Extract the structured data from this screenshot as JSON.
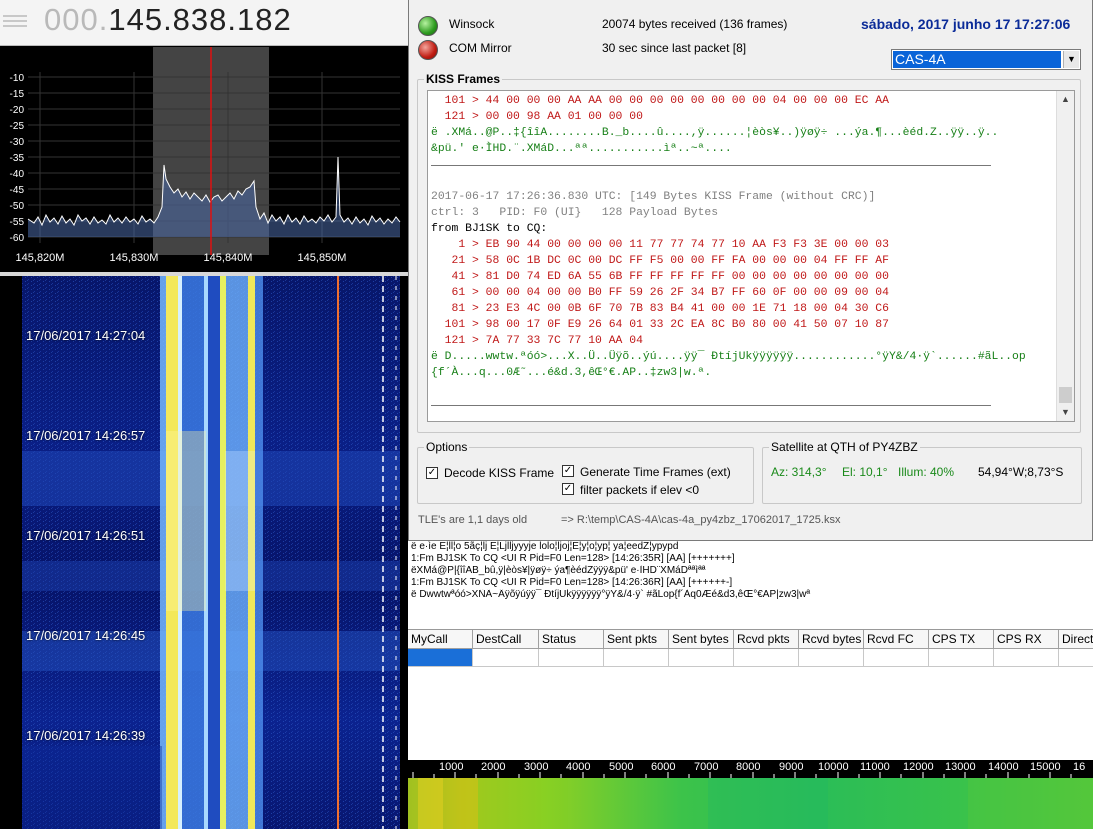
{
  "sdr": {
    "freq_dim": "000.",
    "freq_main": "145.838.182",
    "spectrum": {
      "y_ticks": [
        "-10",
        "-15",
        "-20",
        "-25",
        "-30",
        "-35",
        "-40",
        "-45",
        "-50",
        "-55",
        "-60"
      ],
      "x_ticks": [
        "145,820M",
        "145,830M",
        "145,840M",
        "145,850M"
      ]
    },
    "waterfall_times": [
      "17/06/2017 14:27:04",
      "17/06/2017 14:26:57",
      "17/06/2017 14:26:51",
      "17/06/2017 14:26:45",
      "17/06/2017 14:26:39"
    ]
  },
  "status": {
    "winsock_label": "Winsock",
    "winsock_info": "20074 bytes received (136 frames)",
    "com_label": "COM Mirror",
    "com_info": "30 sec since last packet [8]",
    "date": "sábado, 2017 junho 17  17:27:06",
    "satellite": "CAS-4A"
  },
  "kiss": {
    "legend": "KISS Frames",
    "lines": [
      {
        "c": "r",
        "t": "  101 > 44 00 00 00 AA AA 00 00 00 00 00 00 00 00 04 00 00 00 EC AA"
      },
      {
        "c": "r",
        "t": "  121 > 00 00 98 AA 01 00 00 00"
      },
      {
        "c": "g",
        "t": "ë .XMá..@P..‡{îîA........B._b....û....,ÿ......¦èòs¥..)ÿøÿ÷ ...ýa.¶...èéd.Z..ÿÿ..ÿ.."
      },
      {
        "c": "g",
        "t": "&pü.' e·ÌHD.¨.XMáD...ªª...........ìª..~ª...."
      },
      {
        "c": "sep",
        "t": ""
      },
      {
        "c": "b",
        "t": ""
      },
      {
        "c": "gr",
        "t": "2017-06-17 17:26:36.830 UTC: [149 Bytes KISS Frame (without CRC)]"
      },
      {
        "c": "gr",
        "t": "ctrl: 3   PID: F0 (UI}   128 Payload Bytes"
      },
      {
        "c": "b",
        "t": "from BJ1SK to CQ:"
      },
      {
        "c": "r",
        "t": "    1 > EB 90 44 00 00 00 00 11 77 77 74 77 10 AA F3 F3 3E 00 00 03"
      },
      {
        "c": "r",
        "t": "   21 > 58 0C 1B DC 0C 00 DC FF F5 00 00 FF FA 00 00 00 04 FF FF AF"
      },
      {
        "c": "r",
        "t": "   41 > 81 D0 74 ED 6A 55 6B FF FF FF FF FF 00 00 00 00 00 00 00 00"
      },
      {
        "c": "r",
        "t": "   61 > 00 00 04 00 00 B0 FF 59 26 2F 34 B7 FF 60 0F 00 00 09 00 04"
      },
      {
        "c": "r",
        "t": "   81 > 23 E3 4C 00 0B 6F 70 7B 83 B4 41 00 00 1E 71 18 00 04 30 C6"
      },
      {
        "c": "r",
        "t": "  101 > 98 00 17 0F E9 26 64 01 33 2C EA 8C B0 80 00 41 50 07 10 87"
      },
      {
        "c": "r",
        "t": "  121 > 7A 77 33 7C 77 10 AA 04"
      },
      {
        "c": "g",
        "t": "ë D.....wwtw.ªóó>...X..Ü..Üÿõ..ýú....ÿÿ¯ ÐtíjUkÿÿÿÿÿÿ............°ÿY&/4·ÿ`......#ãL..op"
      },
      {
        "c": "g",
        "t": "{f´À...q...0Æ˜...é&d.3,êŒ°€.AP..‡zw3|w.ª."
      },
      {
        "c": "b",
        "t": ""
      },
      {
        "c": "sep",
        "t": ""
      }
    ]
  },
  "options": {
    "legend": "Options",
    "decode_kiss": "Decode KISS Frame",
    "gen_time": "Generate Time Frames (ext)",
    "filter_elev": "filter packets if elev <0"
  },
  "qth": {
    "legend": "Satellite at QTH of PY4ZBZ",
    "az": "Az: 314,3°",
    "el": "El: 10,1°",
    "illum": "Illum: 40%",
    "pos": "54,94°W;8,73°S"
  },
  "tle_info": "TLE's are 1,1 days old",
  "tle_path": "=> R:\\temp\\CAS-4A\\cas-4a_py4zbz_17062017_1725.ksx",
  "log_lines": [
    "ë e·ìe  E¦ll¦o  5ãç¦lj E¦Ljlljyyyje              lolo¦ljoj¦E¦y¦o¦yp¦ ya¦eedZ¦ypypd",
    "1:Fm BJ1SK To CQ <UI R Pid=F0 Len=128> [14:26:35R] [AA] [+++++++]",
    "ëXMá@P|{îîAB_bû,ÿ|èòs¥|ÿøÿ÷ ýa¶èédZÿÿÿ&pü' e·ÌHD¨XMáDªªìªª",
    "1:Fm BJ1SK To CQ <UI R Pid=F0 Len=128> [14:26:36R] [AA] [++++++-]",
    "ë Dwwtwªóó>XÑÃ~Âÿõÿúÿÿ¯ ÐtíjUkÿÿÿÿÿÿ°ÿY&/4·ÿ`            #ãLop{f´Àq0Æé&d3,êŒ°€AP|zw3|wª"
  ],
  "table": {
    "headers": [
      "MyCall",
      "DestCall",
      "Status",
      "Sent pkts",
      "Sent bytes",
      "Rcvd pkts",
      "Rcvd bytes",
      "Rcvd FC",
      "CPS TX",
      "CPS RX",
      "Directi"
    ]
  },
  "audio": {
    "ticks": [
      "1000",
      "2000",
      "3000",
      "4000",
      "5000",
      "6000",
      "7000",
      "8000",
      "9000",
      "10000",
      "11000",
      "12000",
      "13000",
      "14000",
      "15000",
      "16"
    ]
  }
}
